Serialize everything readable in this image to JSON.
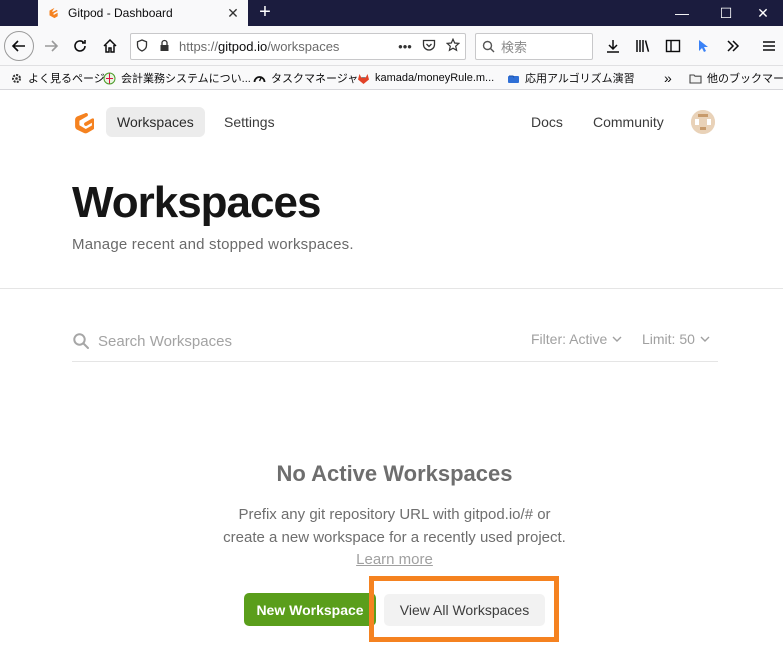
{
  "browser": {
    "tab": {
      "title": "Gitpod - Dashboard",
      "close": "✕"
    },
    "new_tab": "+",
    "window_controls": {
      "minimize": "—",
      "maximize": "☐",
      "close": "✕"
    },
    "url": {
      "prefix": "https://",
      "host": "gitpod.io",
      "path": "/workspaces"
    },
    "url_more": "•••",
    "search_placeholder": "検索",
    "bookmarks": [
      "よく見るページ",
      "会計業務システムについ...",
      "タスクマネージャー",
      "kamada/moneyRule.m...",
      "応用アルゴリズム演習"
    ],
    "bookmarks_overflow": "»",
    "other_bookmarks": "他のブックマーク"
  },
  "nav": {
    "workspaces": "Workspaces",
    "settings": "Settings",
    "docs": "Docs",
    "community": "Community"
  },
  "header": {
    "title": "Workspaces",
    "subtitle": "Manage recent and stopped workspaces."
  },
  "toolbar": {
    "search_placeholder": "Search Workspaces",
    "filter_label": "Filter: Active",
    "limit_label": "Limit: 50"
  },
  "empty_state": {
    "title": "No Active Workspaces",
    "text": "Prefix any git repository URL with gitpod.io/# or create a new workspace for a recently used project.",
    "link": "Learn more"
  },
  "buttons": {
    "new_workspace": "New Workspace",
    "view_all": "View All Workspaces"
  },
  "colors": {
    "brand_orange": "#f58220",
    "primary_green": "#5a9e1b",
    "tabbar_dark": "#1b1c3e",
    "highlight_box": "#f58220"
  }
}
